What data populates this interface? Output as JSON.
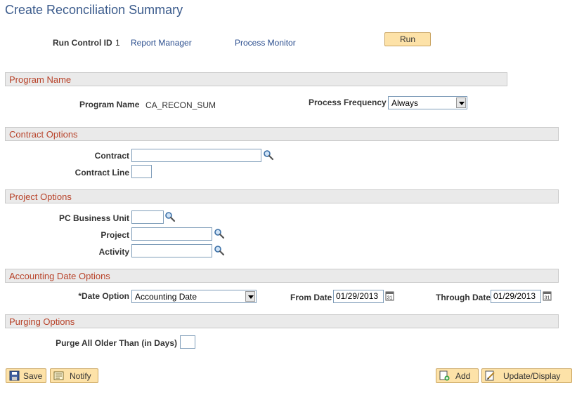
{
  "page": {
    "title": "Create Reconciliation Summary"
  },
  "run_bar": {
    "run_control_label": "Run Control ID",
    "run_control_value": "1",
    "report_manager": "Report Manager",
    "process_monitor": "Process Monitor",
    "run_button": "Run"
  },
  "sections": {
    "program_name": "Program Name",
    "contract_options": "Contract Options",
    "project_options": "Project Options",
    "accounting_date_options": "Accounting Date Options",
    "purging_options": "Purging Options"
  },
  "program": {
    "name_label": "Program Name",
    "name_value": "CA_RECON_SUM",
    "frequency_label": "Process Frequency",
    "frequency_value": "Always"
  },
  "contract": {
    "contract_label": "Contract",
    "contract_value": "",
    "line_label": "Contract Line",
    "line_value": ""
  },
  "project": {
    "bu_label": "PC Business Unit",
    "bu_value": "",
    "project_label": "Project",
    "project_value": "",
    "activity_label": "Activity",
    "activity_value": ""
  },
  "accounting": {
    "date_option_label": "*Date Option",
    "date_option_value": "Accounting Date",
    "from_label": "From Date",
    "from_value": "01/29/2013",
    "through_label": "Through Date",
    "through_value": "01/29/2013"
  },
  "purging": {
    "purge_label": "Purge All Older Than (in Days)",
    "purge_value": ""
  },
  "toolbar": {
    "save": "Save",
    "notify": "Notify",
    "add": "Add",
    "update_display": "Update/Display"
  }
}
